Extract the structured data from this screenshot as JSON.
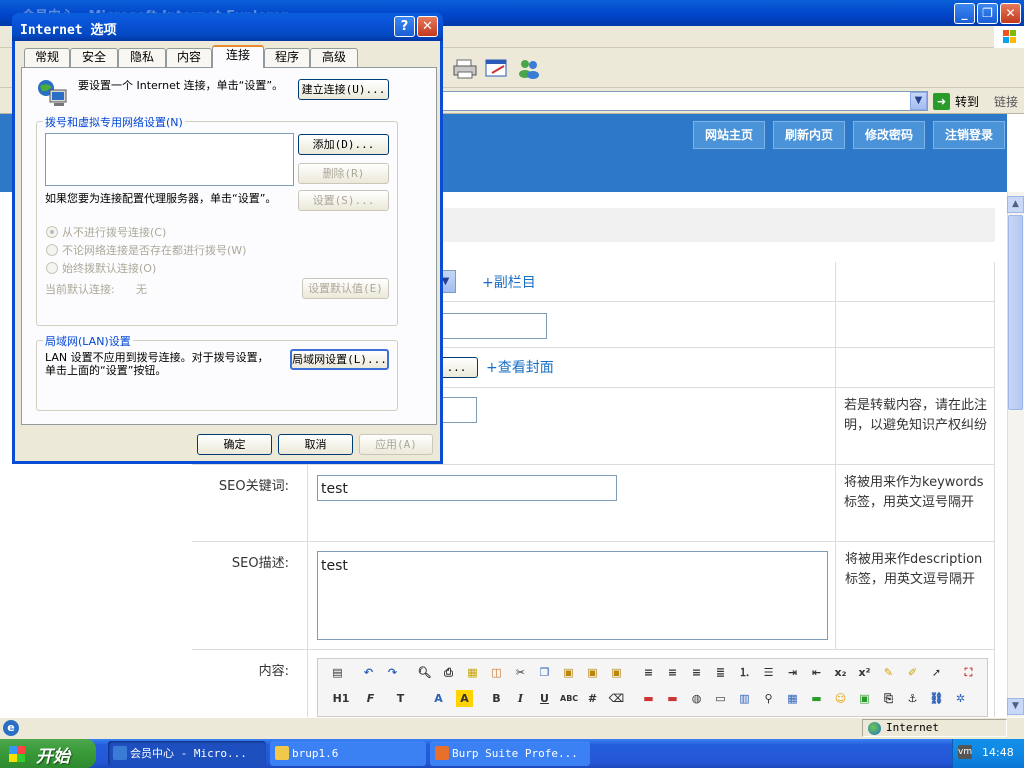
{
  "ie": {
    "window_title": "会员中心 - Microsoft Internet Explorer",
    "address_go": "转到",
    "links": "链接"
  },
  "site": {
    "nav": [
      "网站主页",
      "刷新内页",
      "修改密码",
      "注销登录"
    ]
  },
  "form": {
    "subcolumn_link": "+副栏目",
    "cover_button": "...",
    "cover_link": "+查看封面",
    "source_note": "若是转载内容，请在此注明，以避免知识产权纠纷",
    "seo_keywords_label": "SEO关键词:",
    "seo_keywords_value": "test",
    "seo_keywords_note": "将被用来作为keywords标签，用英文逗号隔开",
    "seo_desc_label": "SEO描述:",
    "seo_desc_value": "test",
    "seo_desc_note": "将被用来作description标签，用英文逗号隔开",
    "content_label": "内容:"
  },
  "editor_toolbar": {
    "row1": [
      "source-icon",
      "undo-icon",
      "redo-icon",
      "preview-icon",
      "print-icon",
      "template-icon",
      "code-icon",
      "cut-icon",
      "copy-icon",
      "paste-icon",
      "paste-text-icon",
      "paste-word-icon",
      "align-left-icon",
      "align-center-icon",
      "align-right-icon",
      "align-justify-icon",
      "ordered-list-icon",
      "unordered-list-icon",
      "indent-icon",
      "outdent-icon",
      "subscript-icon",
      "superscript-icon",
      "clear-format-icon",
      "select-all-icon",
      "cursor-icon",
      "fullscreen-icon"
    ],
    "row2": [
      "H1",
      "F",
      "T",
      "A",
      "A",
      "B",
      "I",
      "U",
      "ABC",
      "#",
      "⌫"
    ]
  },
  "dialog": {
    "title": "Internet 选项",
    "tabs": [
      "常规",
      "安全",
      "隐私",
      "内容",
      "连接",
      "程序",
      "高级"
    ],
    "active_tab": "连接",
    "setup_text": "要设置一个 Internet 连接，单击“设置”。",
    "setup_button": "建立连接(U)...",
    "dialup_group": "拨号和虚拟专用网络设置(N)",
    "add_button": "添加(D)...",
    "remove_button": "删除(R)",
    "settings_text": "如果您要为连接配置代理服务器，单击“设置”。",
    "settings_button": "设置(S)...",
    "radio_never": "从不进行拨号连接(C)",
    "radio_when_absent": "不论网络连接是否存在都进行拨号(W)",
    "radio_always": "始终拨默认连接(O)",
    "current_default_label": "当前默认连接:",
    "current_default_value": "无",
    "set_default_button": "设置默认值(E)",
    "lan_group": "局域网(LAN)设置",
    "lan_text": "LAN 设置不应用到拨号连接。对于拨号设置，单击上面的“设置”按钮。",
    "lan_button": "局域网设置(L)...",
    "ok": "确定",
    "cancel": "取消",
    "apply": "应用(A)",
    "help": "?",
    "close": "✕"
  },
  "status": {
    "zone": "Internet"
  },
  "taskbar": {
    "start": "开始",
    "tasks": [
      "会员中心 - Micro...",
      "brup1.6",
      "Burp Suite Profe..."
    ],
    "clock": "14:48"
  },
  "colors": {
    "xp_blue": "#0b4cd4",
    "site_blue": "#2d79c8",
    "link_blue": "#1a6fc4",
    "dialog_bg": "#ece9d8"
  }
}
